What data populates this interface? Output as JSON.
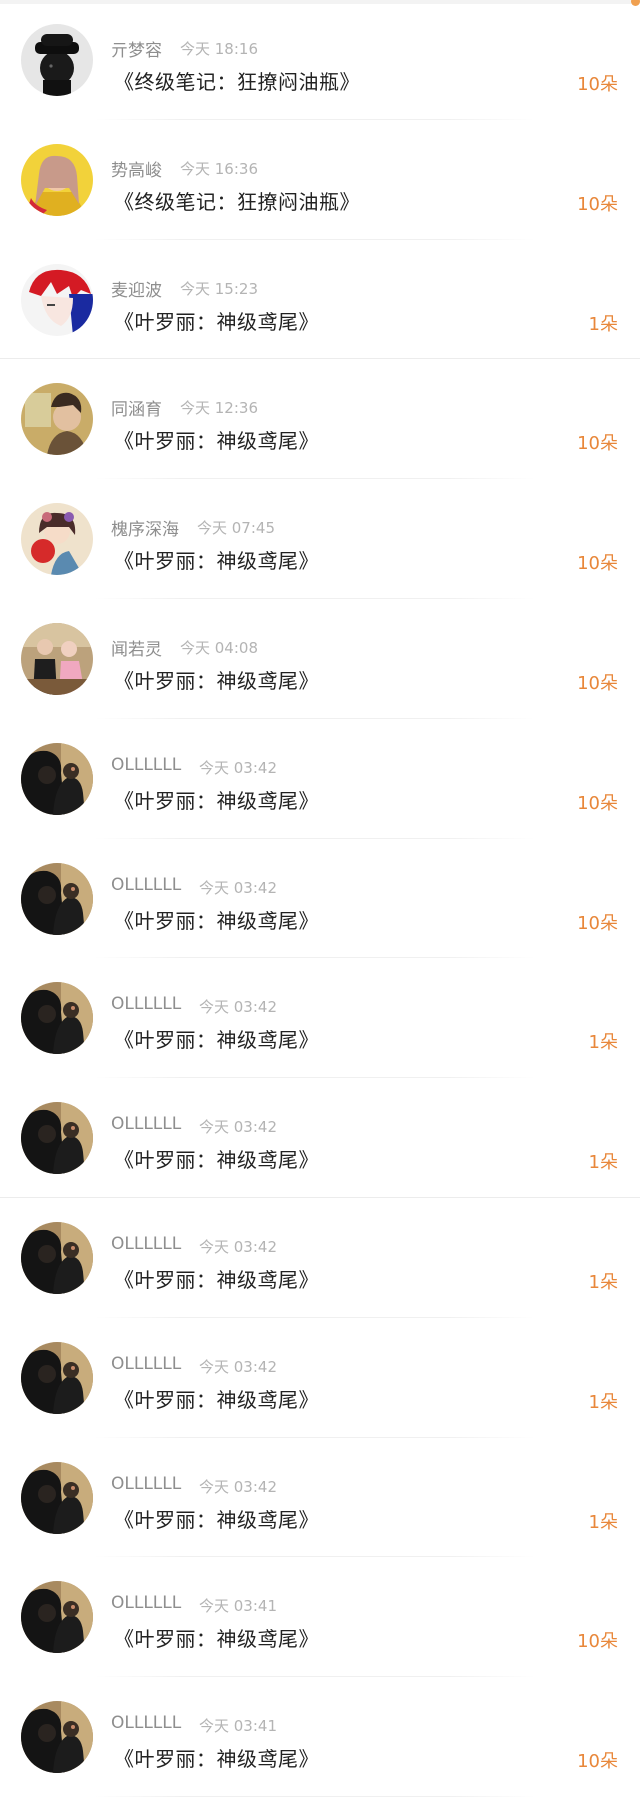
{
  "colors": {
    "accent": "#e8873a",
    "name_text": "#8e8e8e",
    "time_text": "#b4b4b4",
    "title_text": "#222222"
  },
  "gift_records": [
    {
      "name": "亓梦容",
      "time": "今天 18:16",
      "title": "《终级笔记：狂撩闷油瓶》",
      "amount": "10朵",
      "avatar": "avatar-dark-hat"
    },
    {
      "name": "势高峻",
      "time": "今天 16:36",
      "title": "《终级笔记：狂撩闷油瓶》",
      "amount": "10朵",
      "avatar": "avatar-yellow-girl"
    },
    {
      "name": "麦迎波",
      "time": "今天 15:23",
      "title": "《叶罗丽：神级鸢尾》",
      "amount": "1朵",
      "avatar": "avatar-red-hair"
    },
    {
      "name": "同涵育",
      "time": "今天 12:36",
      "title": "《叶罗丽：神级鸢尾》",
      "amount": "10朵",
      "avatar": "avatar-portrait"
    },
    {
      "name": "槐序深海",
      "time": "今天 07:45",
      "title": "《叶罗丽：神级鸢尾》",
      "amount": "10朵",
      "avatar": "avatar-fan-girl"
    },
    {
      "name": "闻若灵",
      "time": "今天 04:08",
      "title": "《叶罗丽：神级鸢尾》",
      "amount": "10朵",
      "avatar": "avatar-couple"
    },
    {
      "name": "OLLLLLL",
      "time": "今天 03:42",
      "title": "《叶罗丽：神级鸢尾》",
      "amount": "10朵",
      "avatar": "avatar-dark-couple"
    },
    {
      "name": "OLLLLLL",
      "time": "今天 03:42",
      "title": "《叶罗丽：神级鸢尾》",
      "amount": "10朵",
      "avatar": "avatar-dark-couple"
    },
    {
      "name": "OLLLLLL",
      "time": "今天 03:42",
      "title": "《叶罗丽：神级鸢尾》",
      "amount": "1朵",
      "avatar": "avatar-dark-couple"
    },
    {
      "name": "OLLLLLL",
      "time": "今天 03:42",
      "title": "《叶罗丽：神级鸢尾》",
      "amount": "1朵",
      "avatar": "avatar-dark-couple"
    },
    {
      "name": "OLLLLLL",
      "time": "今天 03:42",
      "title": "《叶罗丽：神级鸢尾》",
      "amount": "1朵",
      "avatar": "avatar-dark-couple"
    },
    {
      "name": "OLLLLLL",
      "time": "今天 03:42",
      "title": "《叶罗丽：神级鸢尾》",
      "amount": "1朵",
      "avatar": "avatar-dark-couple"
    },
    {
      "name": "OLLLLLL",
      "time": "今天 03:42",
      "title": "《叶罗丽：神级鸢尾》",
      "amount": "1朵",
      "avatar": "avatar-dark-couple"
    },
    {
      "name": "OLLLLLL",
      "time": "今天 03:41",
      "title": "《叶罗丽：神级鸢尾》",
      "amount": "10朵",
      "avatar": "avatar-dark-couple"
    },
    {
      "name": "OLLLLLL",
      "time": "今天 03:41",
      "title": "《叶罗丽：神级鸢尾》",
      "amount": "10朵",
      "avatar": "avatar-dark-couple"
    }
  ]
}
